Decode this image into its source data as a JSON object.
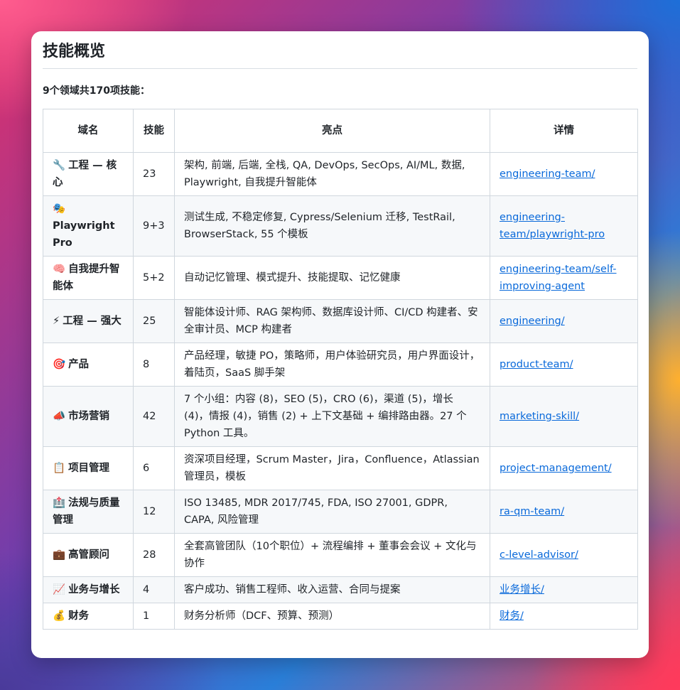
{
  "page": {
    "title": "技能概览",
    "summary": "9个领域共170项技能："
  },
  "table": {
    "headers": [
      "域名",
      "技能",
      "亮点",
      "详情"
    ],
    "rows": [
      {
        "icon": "wrench-icon",
        "emoji": "🔧",
        "domain": "工程 — 核心",
        "skills": "23",
        "highlights": "架构, 前端, 后端, 全栈, QA, DevOps, SecOps, AI/ML, 数据, Playwright, 自我提升智能体",
        "link": "engineering-team/"
      },
      {
        "icon": "theater-masks-icon",
        "emoji": "🎭",
        "domain": "Playwright Pro",
        "skills": "9+3",
        "highlights": "测试生成, 不稳定修复, Cypress/Selenium 迁移, TestRail, BrowserStack, 55 个模板",
        "link": "engineering-team/playwright-pro"
      },
      {
        "icon": "brain-icon",
        "emoji": "🧠",
        "domain": "自我提升智能体",
        "skills": "5+2",
        "highlights": "自动记忆管理、模式提升、技能提取、记忆健康",
        "link": "engineering-team/self-improving-agent"
      },
      {
        "icon": "lightning-icon",
        "emoji": "⚡",
        "domain": "工程 — 强大",
        "skills": "25",
        "highlights": "智能体设计师、RAG 架构师、数据库设计师、CI/CD 构建者、安全审计员、MCP 构建者",
        "link": "engineering/"
      },
      {
        "icon": "target-icon",
        "emoji": "🎯",
        "domain": "产品",
        "skills": "8",
        "highlights": "产品经理，敏捷 PO，策略师，用户体验研究员，用户界面设计，着陆页，SaaS 脚手架",
        "link": "product-team/"
      },
      {
        "icon": "megaphone-icon",
        "emoji": "📣",
        "domain": "市场营销",
        "skills": "42",
        "highlights": "7 个小组：内容 (8)，SEO (5)，CRO (6)，渠道 (5)，增长 (4)，情报 (4)，销售 (2) + 上下文基础 + 编排路由器。27 个 Python 工具。",
        "link": "marketing-skill/"
      },
      {
        "icon": "clipboard-icon",
        "emoji": "📋",
        "domain": "项目管理",
        "skills": "6",
        "highlights": "资深项目经理，Scrum Master，Jira，Confluence，Atlassian 管理员，模板",
        "link": "project-management/"
      },
      {
        "icon": "hospital-icon",
        "emoji": "🏥",
        "domain": "法规与质量管理",
        "skills": "12",
        "highlights": "ISO 13485, MDR 2017/745, FDA, ISO 27001, GDPR, CAPA, 风险管理",
        "link": "ra-qm-team/"
      },
      {
        "icon": "briefcase-icon",
        "emoji": "💼",
        "domain": "高管顾问",
        "skills": "28",
        "highlights": "全套高管团队（10个职位）+ 流程编排 + 董事会会议 + 文化与协作",
        "link": "c-level-advisor/"
      },
      {
        "icon": "chart-increasing-icon",
        "emoji": "📈",
        "domain": "业务与增长",
        "skills": "4",
        "highlights": "客户成功、销售工程师、收入运营、合同与提案",
        "link": "业务增长/"
      },
      {
        "icon": "money-bag-icon",
        "emoji": "💰",
        "domain": "财务",
        "skills": "1",
        "highlights": "财务分析师（DCF、预算、预测）",
        "link": "财务/"
      }
    ]
  }
}
